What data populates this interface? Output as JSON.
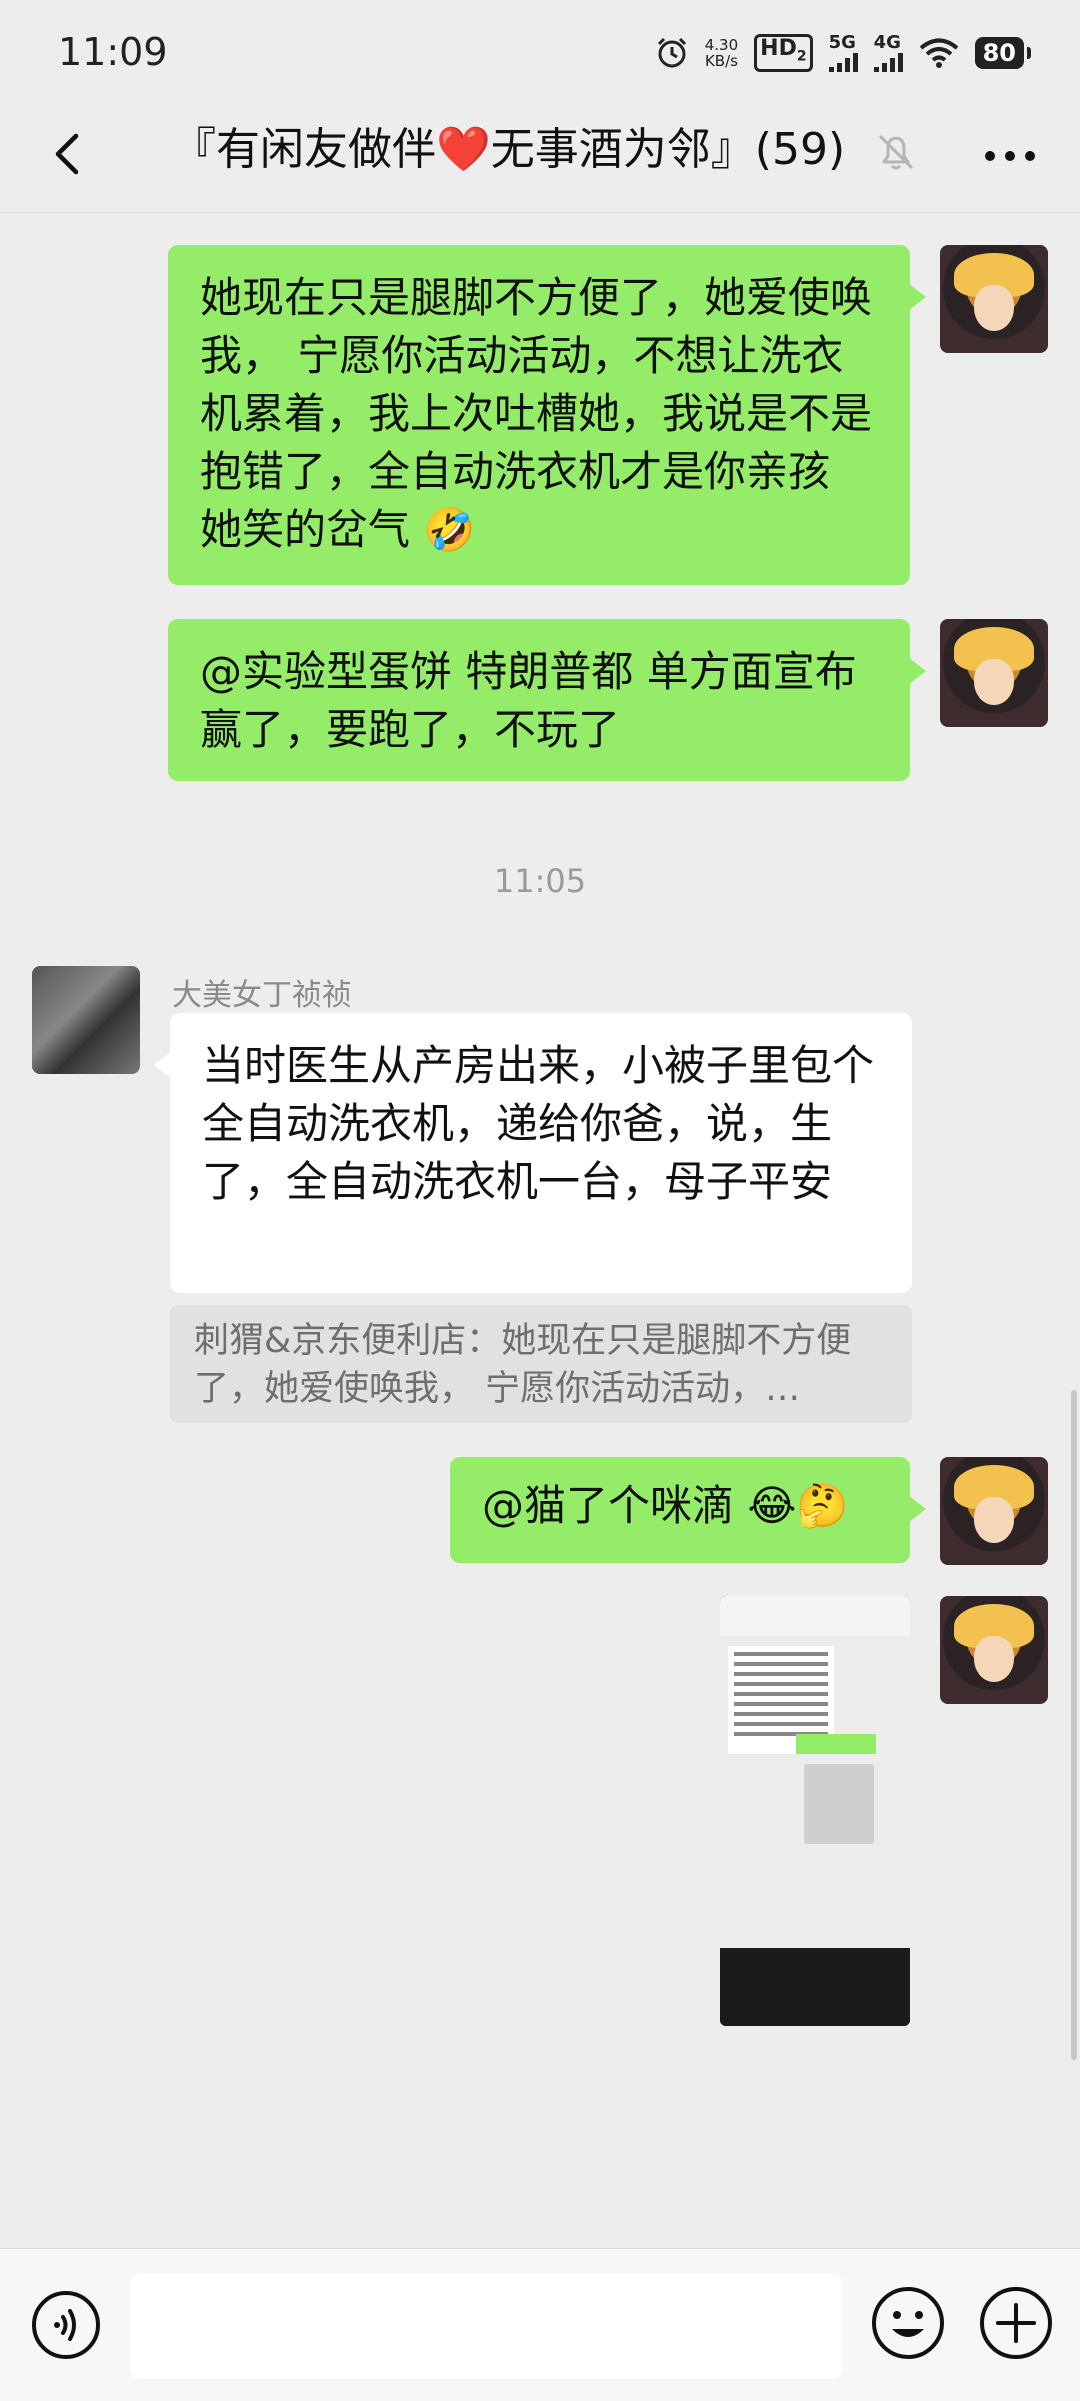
{
  "status_bar": {
    "time": "11:09",
    "net_speed_value": "4.30",
    "net_speed_unit": "KB/s",
    "hd_label": "HD",
    "hd_sub": "2",
    "net1": "5G",
    "net2": "4G",
    "battery": "80"
  },
  "header": {
    "title": "『有闲友做伴❤️无事酒为邻』(59)"
  },
  "messages": {
    "m1": "她现在只是腿脚不方便了，她爱使唤我， 宁愿你活动活动，不想让洗衣机累着，我上次吐槽她，我说是不是抱错了，全自动洗衣机才是你亲孩  她笑的岔气 🤣",
    "m2": "@实验型蛋饼  特朗普都 单方面宣布赢了，要跑了，不玩了",
    "time_divider": "11:05",
    "m3_sender": "大美女丁祯祯",
    "m3": "当时医生从产房出来，小被子里包个全自动洗衣机，递给你爸，说，生了，全自动洗衣机一台，母子平安",
    "m3_quote": "刺猬&京东便利店：她现在只是腿脚不方便了，她爱使唤我， 宁愿你活动活动，…",
    "m4": "@猫了个咪滴  😂🤔"
  },
  "input_bar": {
    "placeholder": ""
  },
  "colors": {
    "background": "#ededed",
    "sent_bubble": "#95ec69",
    "received_bubble": "#ffffff"
  }
}
